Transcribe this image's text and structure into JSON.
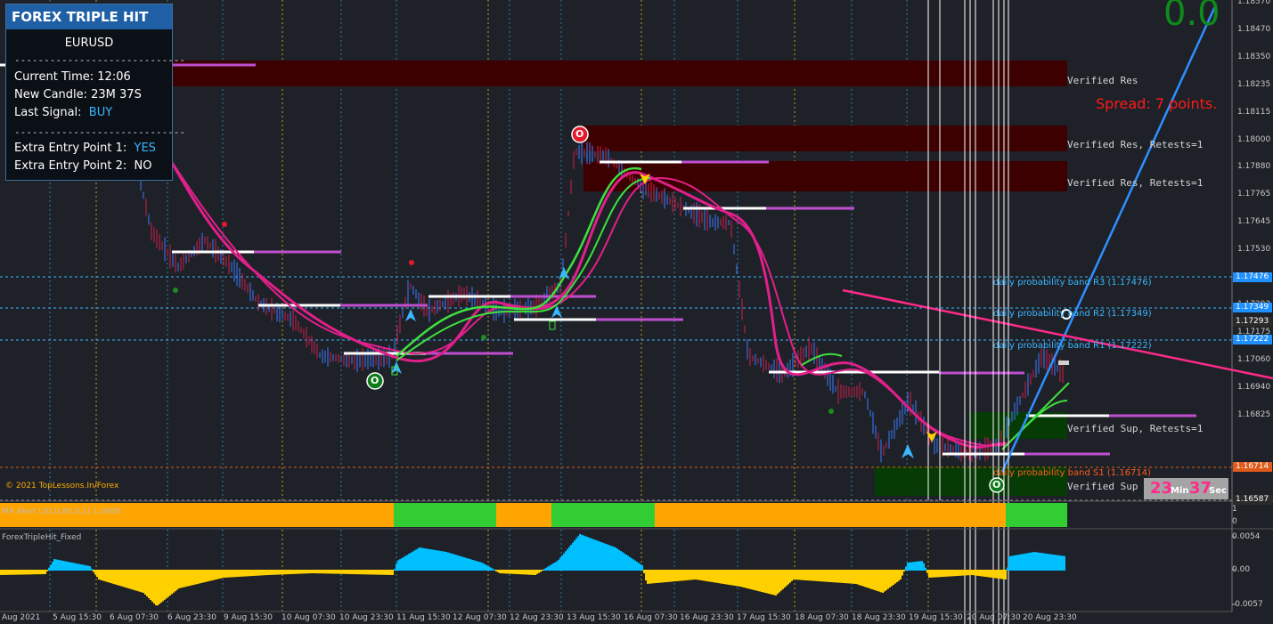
{
  "panel": {
    "title": "FOREX TRIPLE HIT",
    "symbol": "EURUSD",
    "separator": "-----------------------------",
    "current_time": "Current Time: 12:06",
    "new_candle": "New Candle: 23M 37S",
    "last_signal_label": "Last Signal:",
    "last_signal_value": "BUY",
    "extra1_label": "Extra Entry Point 1:",
    "extra1_value": "YES",
    "extra2_label": "Extra Entry Point 2:",
    "extra2_value": "NO"
  },
  "overlay": {
    "big_number": "0.0",
    "spread": "Spread: 7 points.",
    "copyright": "© 2021 TopLessons.In/Forex",
    "timer_minutes": "23",
    "timer_min_unit": "Min",
    "timer_seconds": "37",
    "timer_sec_unit": "Sec",
    "signal_markers": [
      "O",
      "O",
      "O"
    ]
  },
  "zones": {
    "res1": "Verified Res",
    "res2": "Verified Res, Retests=1",
    "res3": "Verified Res, Retests=1",
    "sup1": "Verified Sup, Retests=1",
    "sup2": "Verified Sup"
  },
  "bands": {
    "r3": "daily probability band R3 (1.17476)",
    "r2": "daily probability band R2 (1.17349)",
    "r1": "daily probability band R1 (1.17222)",
    "s1": "daily probability band S1 (1.16714)"
  },
  "price_axis": [
    "1.18570",
    "1.18470",
    "1.18350",
    "1.18235",
    "1.18115",
    "1.18000",
    "1.17880",
    "1.17765",
    "1.17645",
    "1.17530",
    "1.17410",
    "1.17293",
    "1.17175",
    "1.17060",
    "1.16940",
    "1.16825"
  ],
  "price_tags": [
    {
      "value": "1.17476",
      "color": "#1e90ff"
    },
    {
      "value": "1.17349",
      "color": "#1e90ff"
    },
    {
      "value": "1.17293",
      "color": "#2a2a2a"
    },
    {
      "value": "1.17222",
      "color": "#1e90ff"
    },
    {
      "value": "1.16714",
      "color": "#e05a1a"
    },
    {
      "value": "1.16587",
      "color": "#2a2a2a"
    }
  ],
  "subwindow1": {
    "label": "MA Alert (20,0,80,0,1)  1.0000",
    "axis": [
      "1",
      "0"
    ],
    "segments": [
      {
        "from": 0,
        "to": 442,
        "color": "#ffa500"
      },
      {
        "from": 442,
        "to": 557,
        "color": "#32cd32"
      },
      {
        "from": 557,
        "to": 619,
        "color": "#ffa500"
      },
      {
        "from": 619,
        "to": 735,
        "color": "#32cd32"
      },
      {
        "from": 735,
        "to": 1129,
        "color": "#ffa500"
      },
      {
        "from": 1129,
        "to": 1198,
        "color": "#32cd32"
      }
    ]
  },
  "subwindow2": {
    "label": "ForexTripleHit_Fixed",
    "axis": [
      "0.0054",
      "0.00",
      "-0.0057"
    ]
  },
  "time_axis": [
    "Aug 2021",
    "5 Aug 15:30",
    "6 Aug 07:30",
    "6 Aug 23:30",
    "9 Aug 15:30",
    "10 Aug 07:30",
    "10 Aug 23:30",
    "11 Aug 15:30",
    "12 Aug 07:30",
    "12 Aug 23:30",
    "13 Aug 15:30",
    "16 Aug 07:30",
    "16 Aug 23:30",
    "17 Aug 15:30",
    "18 Aug 07:30",
    "18 Aug 23:30",
    "19 Aug 15:30",
    "20 Aug 07:30",
    "20 Aug 23:30"
  ]
}
